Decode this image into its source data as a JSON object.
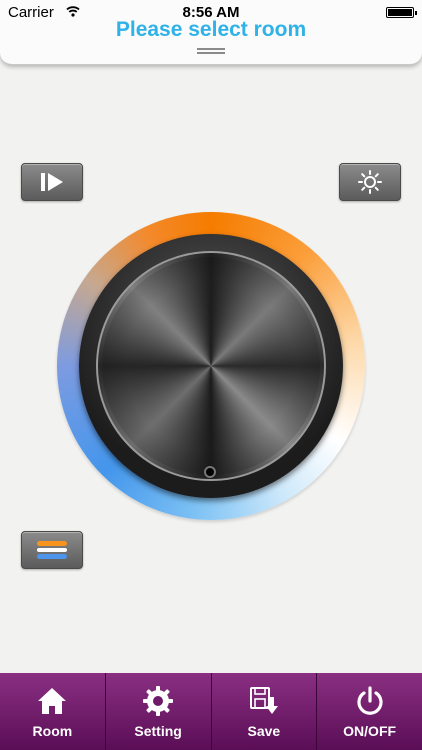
{
  "status_bar": {
    "carrier": "Carrier",
    "time": "8:56 AM"
  },
  "header": {
    "title": "Please select room"
  },
  "controls": {
    "play_icon": "play-step-icon",
    "brightness_icon": "sun-icon",
    "mode_icon": "color-bars-icon"
  },
  "dial": {
    "ring_colors": [
      "#f57c00",
      "#ffffff",
      "#4496ec"
    ]
  },
  "tabbar": {
    "room": "Room",
    "setting": "Setting",
    "save": "Save",
    "onoff": "ON/OFF"
  },
  "colors": {
    "title": "#2fb2e7",
    "tabbar": "#6e1a69",
    "accent_orange": "#f57c00",
    "accent_blue": "#4496ec"
  }
}
